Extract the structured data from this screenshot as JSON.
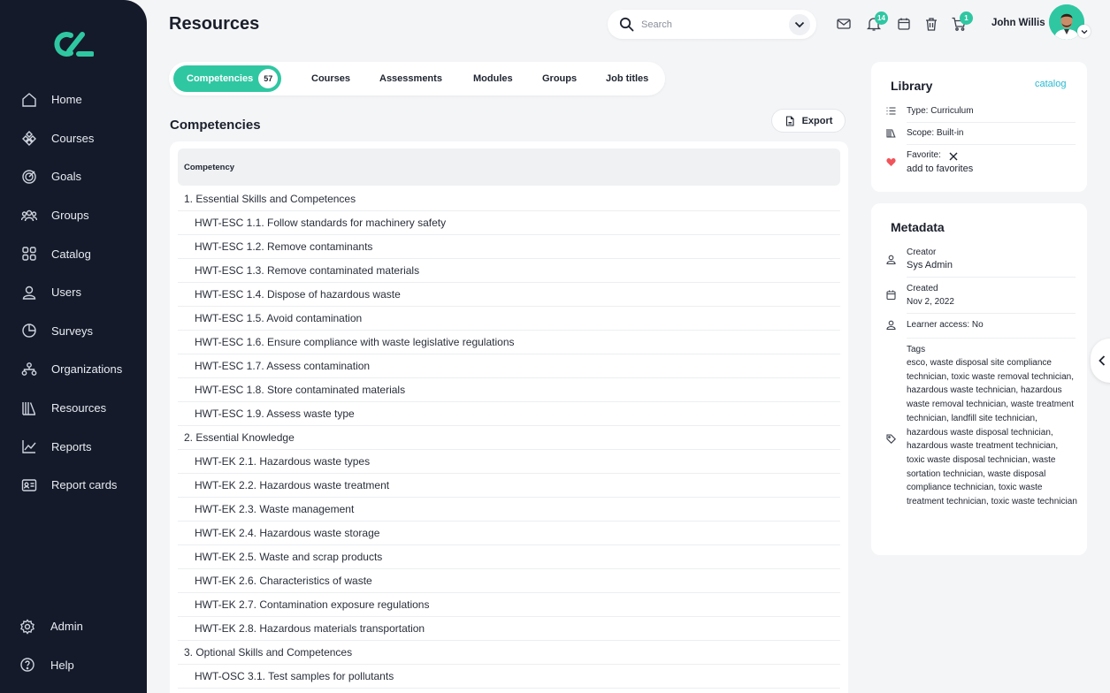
{
  "sidebar": {
    "items": [
      {
        "label": "Home",
        "icon": "home-icon"
      },
      {
        "label": "Courses",
        "icon": "courses-icon"
      },
      {
        "label": "Goals",
        "icon": "goals-icon"
      },
      {
        "label": "Groups",
        "icon": "groups-icon"
      },
      {
        "label": "Catalog",
        "icon": "catalog-icon"
      },
      {
        "label": "Users",
        "icon": "users-icon"
      },
      {
        "label": "Surveys",
        "icon": "surveys-icon"
      },
      {
        "label": "Organizations",
        "icon": "organizations-icon"
      },
      {
        "label": "Resources",
        "icon": "resources-icon"
      },
      {
        "label": "Reports",
        "icon": "reports-icon"
      },
      {
        "label": "Report cards",
        "icon": "report-cards-icon"
      }
    ],
    "bottom": [
      {
        "label": "Admin",
        "icon": "gear-icon"
      },
      {
        "label": "Help",
        "icon": "help-icon"
      }
    ]
  },
  "header": {
    "title": "Resources",
    "search_placeholder": "Search",
    "notifications_count": "14",
    "cart_count": "1",
    "user_name": "John Willis"
  },
  "tabs": [
    {
      "label": "Competencies",
      "count": "57",
      "active": true
    },
    {
      "label": "Courses"
    },
    {
      "label": "Assessments"
    },
    {
      "label": "Modules"
    },
    {
      "label": "Groups"
    },
    {
      "label": "Job titles"
    }
  ],
  "main": {
    "section_title": "Competencies",
    "export_label": "Export",
    "column_header": "Competency",
    "rows": [
      {
        "text": "1. Essential Skills and Competences",
        "level": 0
      },
      {
        "text": "HWT-ESC 1.1. Follow standards for machinery safety",
        "level": 1
      },
      {
        "text": "HWT-ESC 1.2. Remove contaminants",
        "level": 1
      },
      {
        "text": "HWT-ESC 1.3. Remove contaminated materials",
        "level": 1
      },
      {
        "text": "HWT-ESC 1.4. Dispose of hazardous waste",
        "level": 1
      },
      {
        "text": "HWT-ESC 1.5. Avoid contamination",
        "level": 1
      },
      {
        "text": "HWT-ESC 1.6. Ensure compliance with waste legislative regulations",
        "level": 1
      },
      {
        "text": "HWT-ESC 1.7. Assess contamination",
        "level": 1
      },
      {
        "text": "HWT-ESC 1.8. Store contaminated materials",
        "level": 1
      },
      {
        "text": "HWT-ESC 1.9. Assess waste type",
        "level": 1
      },
      {
        "text": "2. Essential Knowledge",
        "level": 0
      },
      {
        "text": "HWT-EK 2.1. Hazardous waste types",
        "level": 1
      },
      {
        "text": "HWT-EK 2.2. Hazardous waste treatment",
        "level": 1
      },
      {
        "text": "HWT-EK 2.3. Waste management",
        "level": 1
      },
      {
        "text": "HWT-EK 2.4. Hazardous waste storage",
        "level": 1
      },
      {
        "text": "HWT-EK 2.5. Waste and scrap products",
        "level": 1
      },
      {
        "text": "HWT-EK 2.6. Characteristics of waste",
        "level": 1
      },
      {
        "text": "HWT-EK 2.7. Contamination exposure regulations",
        "level": 1
      },
      {
        "text": "HWT-EK 2.8. Hazardous materials transportation",
        "level": 1
      },
      {
        "text": "3. Optional Skills and Competences",
        "level": 0
      },
      {
        "text": "HWT-OSC 3.1. Test samples for pollutants",
        "level": 1
      }
    ]
  },
  "library": {
    "title": "Library",
    "catalog_link": "catalog",
    "type": "Type: Curriculum",
    "scope": "Scope: Built-in",
    "favorite_label": "Favorite:",
    "add_favorites": "add to favorites"
  },
  "metadata": {
    "title": "Metadata",
    "creator_label": "Creator",
    "creator_value": "Sys Admin",
    "created_label": "Created",
    "created_value": "Nov 2, 2022",
    "learner_access": "Learner access: No",
    "tags_label": "Tags",
    "tags_value": "esco, waste disposal site compliance technician, toxic waste removal technician, hazardous waste technician, hazardous waste removal technician, waste treatment technician, landfill site technician, hazardous waste disposal technician, hazardous waste treatment technician, toxic waste disposal technician, waste sortation technician, waste disposal compliance technician, toxic waste treatment technician, toxic waste technician"
  },
  "colors": {
    "sidebar_bg": "#141a2a",
    "accent": "#2fc7a2",
    "link": "#27b9d1",
    "page_bg": "#f4f5f7"
  }
}
